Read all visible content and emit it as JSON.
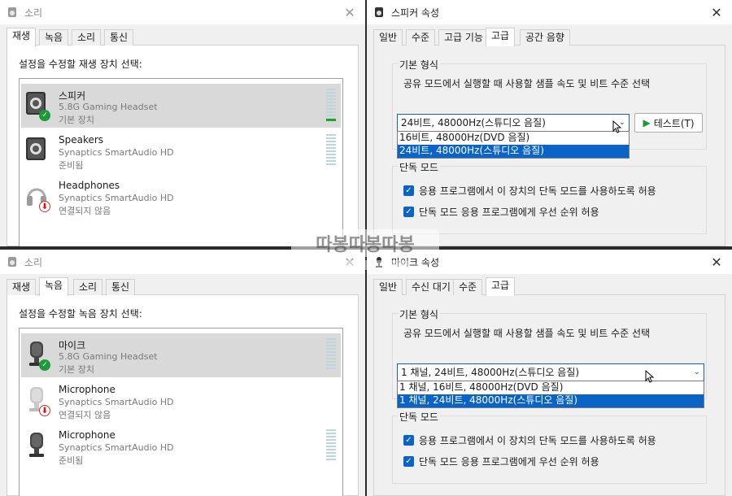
{
  "tl": {
    "title": "소리",
    "tabs": [
      "재생",
      "녹음",
      "소리",
      "통신"
    ],
    "label": "설정을 수정할 재생 장치 선택:",
    "devices": [
      {
        "name": "스피커",
        "sub": "5.8G Gaming Headset",
        "status": "기본 장치"
      },
      {
        "name": "Speakers",
        "sub": "Synaptics SmartAudio HD",
        "status": "준비됨"
      },
      {
        "name": "Headphones",
        "sub": "Synaptics SmartAudio HD",
        "status": "연결되지 않음"
      }
    ]
  },
  "tr": {
    "title": "스피커 속성",
    "tabs": [
      "일반",
      "수준",
      "고급 기능",
      "고급",
      "공간 음향"
    ],
    "group1_title": "기본 형식",
    "group1_desc": "공유 모드에서 실행할 때 사용할 샘플 속도 및 비트 수준 선택",
    "select_value": "24비트, 48000Hz(스튜디오 음질)",
    "options": [
      "16비트, 48000Hz(DVD 음질)",
      "24비트, 48000Hz(스튜디오 음질)"
    ],
    "test_label": "테스트(T)",
    "group2_title": "단독 모드",
    "check1": "응용 프로그램에서 이 장치의 단독 모드를 사용하도록 허용",
    "check2": "단독 모드 응용 프로그램에게 우선 순위 허용"
  },
  "bl": {
    "title": "소리",
    "tabs": [
      "재생",
      "녹음",
      "소리",
      "통신"
    ],
    "label": "설정을 수정할 녹음 장치 선택:",
    "devices": [
      {
        "name": "마이크",
        "sub": "5.8G Gaming Headset",
        "status": "기본 장치"
      },
      {
        "name": "Microphone",
        "sub": "Synaptics SmartAudio HD",
        "status": "연결되지 않음"
      },
      {
        "name": "Microphone",
        "sub": "Synaptics SmartAudio HD",
        "status": "준비됨"
      }
    ]
  },
  "br": {
    "title": "마이크 속성",
    "tabs": [
      "일반",
      "수신 대기",
      "수준",
      "고급"
    ],
    "group1_title": "기본 형식",
    "group1_desc": "공유 모드에서 실행할 때 사용할 샘플 속도 및 비트 수준 선택",
    "select_value": "1 채널, 24비트, 48000Hz(스튜디오 음질)",
    "options": [
      "1 채널, 16비트, 48000Hz(DVD 음질)",
      "1 채널, 24비트, 48000Hz(스튜디오 음질)"
    ],
    "group2_title": "단독 모드",
    "check1": "응용 프로그램에서 이 장치의 단독 모드를 사용하도록 허용",
    "check2": "단독 모드 응용 프로그램에게 우선 순위 허용"
  },
  "colors": {
    "accent": "#0a64c8",
    "ok": "#1c9a3a",
    "meter": "#bcd6dc"
  },
  "watermark": "따봉따봉따봉"
}
